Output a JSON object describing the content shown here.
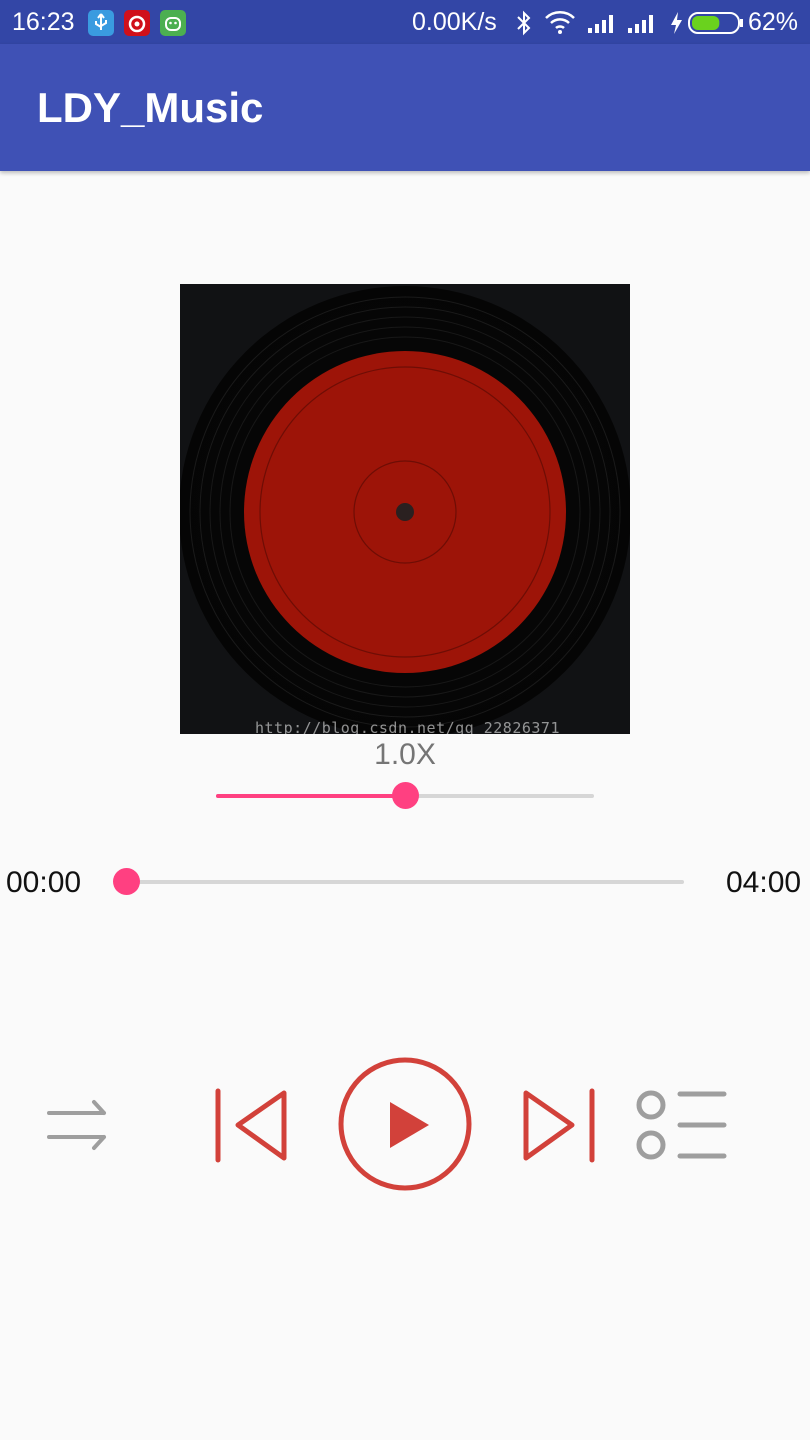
{
  "status_bar": {
    "time": "16:23",
    "net_speed": "0.00K/s",
    "battery_percent": "62%",
    "battery_level": 0.62,
    "icons": [
      "usb-icon",
      "netease-music-icon",
      "android-face-icon",
      "bluetooth-icon",
      "wifi-icon",
      "signal-icon",
      "signal-icon",
      "charging-icon",
      "battery-icon"
    ]
  },
  "app_bar": {
    "title": "LDY_Music"
  },
  "cover": {
    "watermark": "http://blog.csdn.net/qq_22826371"
  },
  "playback_speed": {
    "label": "1.0X",
    "fraction": 0.5
  },
  "progress": {
    "current_time": "00:00",
    "total_time": "04:00",
    "fraction": 0.0
  },
  "controls": {
    "shuffle": "shuffle-icon",
    "previous": "skip-previous-icon",
    "play": "play-icon",
    "next": "skip-next-icon",
    "playlist": "playlist-icon"
  },
  "colors": {
    "primary": "#3f51b5",
    "primary_dark": "#3346a6",
    "accent": "#ff4081",
    "control_red": "#d2413a",
    "control_gray": "#9e9e9e",
    "record_label": "#9d1408"
  }
}
